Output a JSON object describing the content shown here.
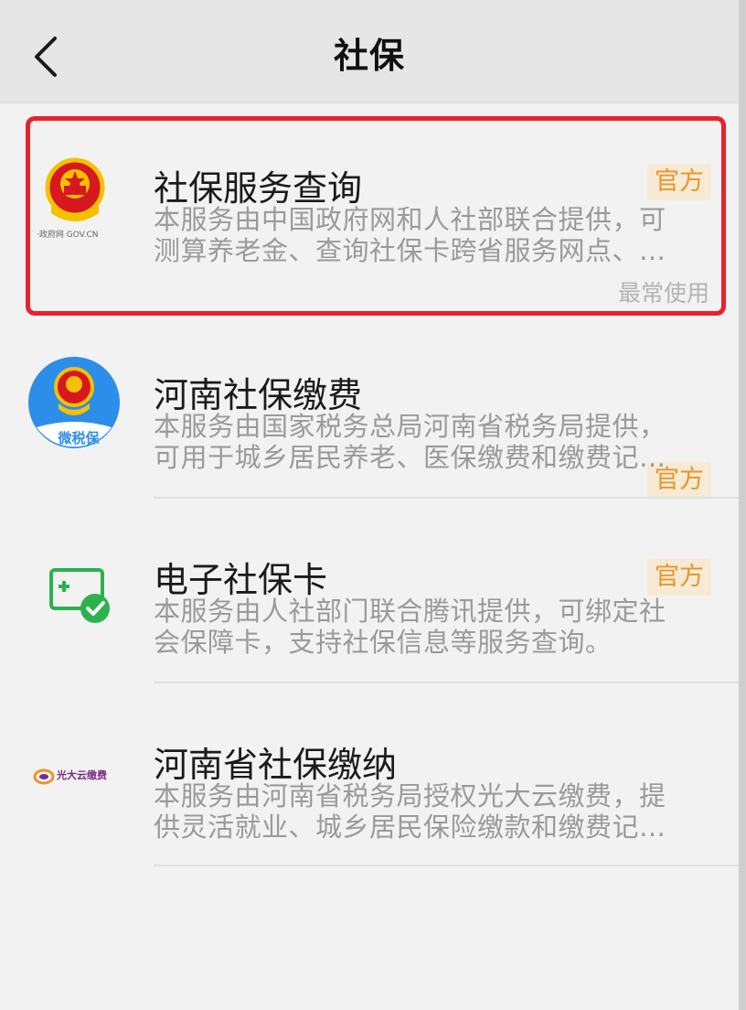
{
  "header": {
    "title": "社保",
    "back_icon": "chevron-left-icon"
  },
  "items": [
    {
      "icon": "national-emblem-gov-icon",
      "icon_caption": "·政府网 GOV.CN",
      "title": "社保服务查询",
      "badge": "官方",
      "desc_line1": "本服务由中国政府网和人社部联合提供，可",
      "desc_line2": "测算养老金、查询社保卡跨省服务网点、…",
      "usage": "最常使用"
    },
    {
      "icon": "wei-shui-bao-icon",
      "icon_caption": "微税保",
      "title": "河南社保缴费",
      "badge": "官方",
      "desc_line1": "本服务由国家税务总局河南省税务局提供，",
      "desc_line2": "可用于城乡居民养老、医保缴费和缴费记…"
    },
    {
      "icon": "e-social-card-icon",
      "title": "电子社保卡",
      "badge": "官方",
      "desc_line1": "本服务由人社部门联合腾讯提供，可绑定社",
      "desc_line2": "会保障卡，支持社保信息等服务查询。"
    },
    {
      "icon": "guangda-cloud-pay-icon",
      "icon_caption": "光大云缴费",
      "title": "河南省社保缴纳",
      "desc_line1": "本服务由河南省税务局授权光大云缴费，提",
      "desc_line2": "供灵活就业、城乡居民保险缴款和缴费记…"
    }
  ],
  "colors": {
    "badge_text": "#e8962a",
    "badge_bg": "#f6ead4",
    "highlight": "#e8232b",
    "emblem_red": "#d7191f",
    "weishuibao_blue": "#2c8ee8",
    "wechat_green": "#2bb24c"
  }
}
